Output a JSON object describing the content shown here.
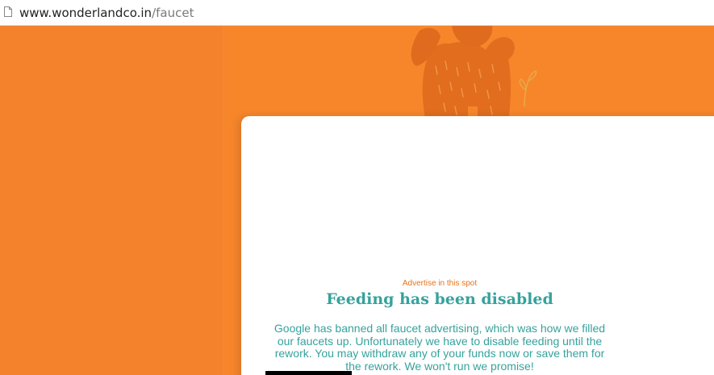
{
  "browser": {
    "url_domain": "www.wonderlandco.in",
    "url_path": "/faucet",
    "page_icon": "page-icon"
  },
  "card": {
    "advertise_label": "Advertise in this spot",
    "heading": "Feeding has been disabled",
    "message": "Google has banned all faucet advertising, which was how we filled our faucets up. Unfortunately we have to disable feeding until the rework. You may withdraw any of your funds now or save them for the rework. We won't run we promise!"
  },
  "colors": {
    "background": "#f7862b",
    "heading": "#36a29c",
    "advertise": "#e8731a",
    "illustration": "#d8621a"
  }
}
